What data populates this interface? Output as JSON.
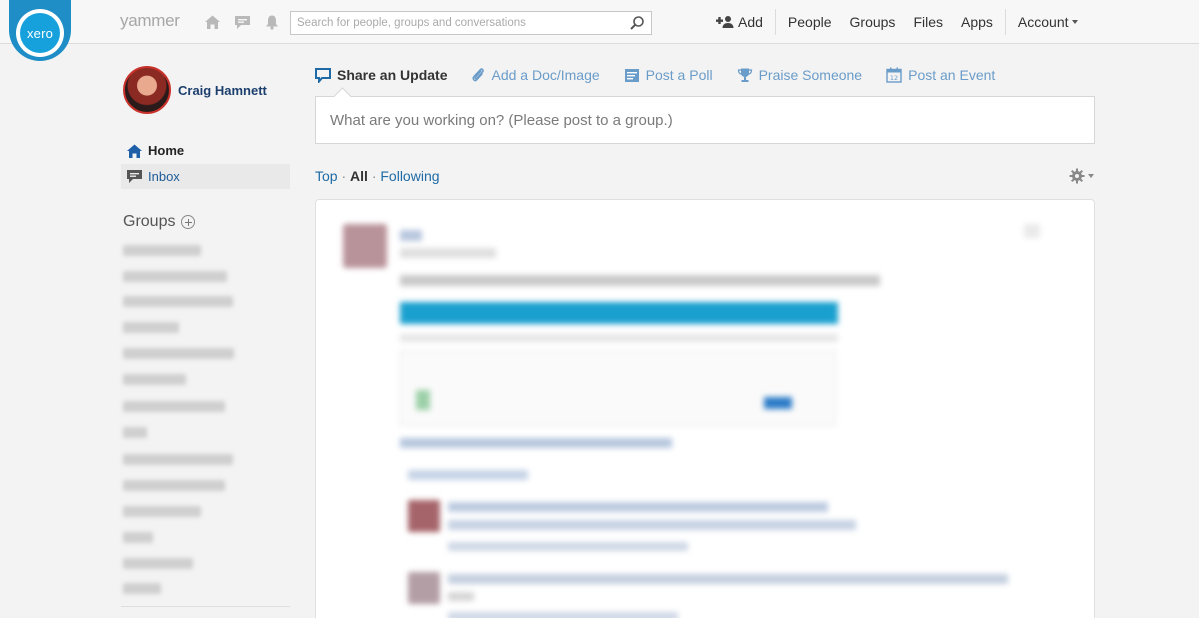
{
  "header": {
    "logo_text": "xero",
    "brand": "yammer",
    "search_placeholder": "Search for people, groups and conversations",
    "nav": {
      "add": "Add",
      "people": "People",
      "groups": "Groups",
      "files": "Files",
      "apps": "Apps",
      "account": "Account"
    },
    "icons": [
      "home-icon",
      "chat-icon",
      "bell-icon",
      "search-icon",
      "add-user-icon"
    ]
  },
  "sidebar": {
    "user_name": "Craig Hamnett",
    "home": "Home",
    "inbox": "Inbox",
    "groups_title": "Groups"
  },
  "publisher": {
    "tabs": [
      {
        "label": "Share an Update",
        "icon": "speech-bubble-icon",
        "active": true
      },
      {
        "label": "Add a Doc/Image",
        "icon": "paperclip-icon",
        "active": false
      },
      {
        "label": "Post a Poll",
        "icon": "poll-icon",
        "active": false
      },
      {
        "label": "Praise Someone",
        "icon": "trophy-icon",
        "active": false
      },
      {
        "label": "Post an Event",
        "icon": "calendar-icon",
        "active": false
      }
    ],
    "placeholder": "What are you working on? (Please post to a group.)"
  },
  "feed_filter": {
    "top": "Top",
    "all": "All",
    "following": "Following",
    "separator": "·"
  },
  "colors": {
    "accent": "#1d6aa6",
    "xero_blue": "#16a1dd",
    "tab_blue": "#6a9cc9"
  }
}
